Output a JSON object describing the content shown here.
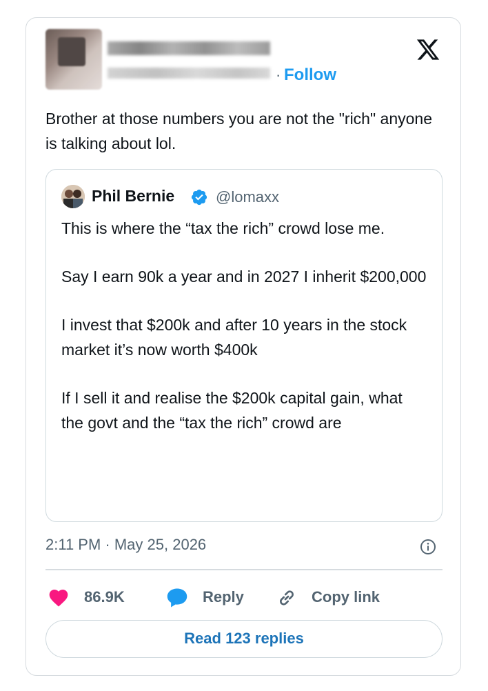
{
  "header": {
    "follow_label": "Follow",
    "separator": "·"
  },
  "tweet": {
    "text": "Brother at those numbers you are not the \"rich\" anyone is talking about lol."
  },
  "quote": {
    "name": "Phil Bernie",
    "handle": "@lomaxx",
    "paragraphs": [
      "This is where the “tax the rich” crowd lose me.",
      "Say I earn 90k a year and in 2027 I inherit $200,000",
      "I invest that $200k and after 10 years in the stock market it’s now worth $400k",
      "If I sell it and realise the $200k capital gain, what the govt and the “tax the rich” crowd are"
    ]
  },
  "meta": {
    "timestamp": "2:11 PM · May 25, 2026"
  },
  "actions": {
    "likes": "86.9K",
    "reply_label": "Reply",
    "copy_link_label": "Copy link"
  },
  "footer": {
    "read_replies_label": "Read 123 replies"
  },
  "colors": {
    "accent": "#1d9bf0",
    "heart": "#f91880",
    "muted": "#536471"
  }
}
